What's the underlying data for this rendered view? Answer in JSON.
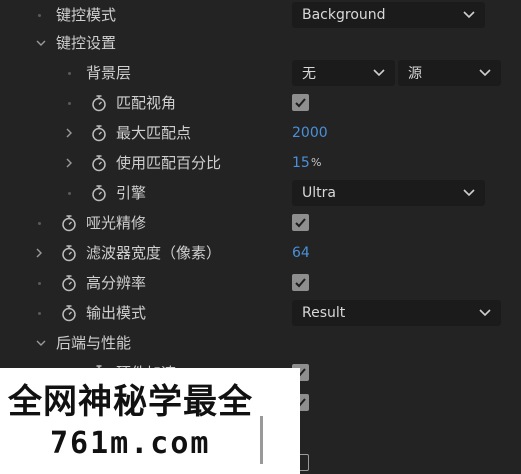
{
  "rows": {
    "key_mode": {
      "label": "键控模式",
      "value": "Background"
    },
    "key_settings": {
      "label": "键控设置"
    },
    "bg_layer": {
      "label": "背景层",
      "value_a": "无",
      "value_b": "源"
    },
    "match_view": {
      "label": "匹配视角",
      "checked": true
    },
    "max_match": {
      "label": "最大匹配点",
      "value": "2000"
    },
    "match_percent": {
      "label": "使用匹配百分比",
      "value": "15",
      "unit": "%"
    },
    "engine": {
      "label": "引擎",
      "value": "Ultra"
    },
    "matte_refine": {
      "label": "哑光精修",
      "checked": true
    },
    "filter_width": {
      "label": "滤波器宽度（像素）",
      "value": "64"
    },
    "high_res": {
      "label": "高分辨率",
      "checked": true
    },
    "output_mode": {
      "label": "输出模式",
      "value": "Result"
    },
    "backend": {
      "label": "后端与性能"
    },
    "hw_accel": {
      "label": "硬件加速",
      "checked": true
    }
  },
  "watermark": {
    "line1": "全网神秘学最全",
    "line2": "761m.com"
  },
  "colors": {
    "accent": "#4a90d9",
    "bg": "#232323",
    "field": "#1b1b1b"
  }
}
